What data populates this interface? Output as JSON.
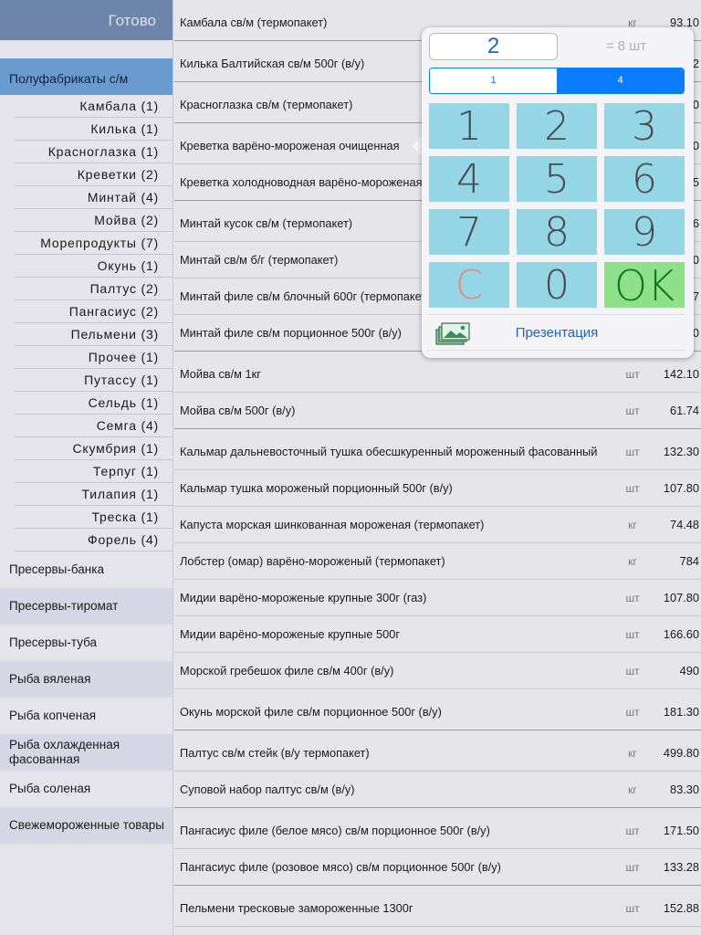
{
  "sidebar": {
    "done_label": "Готово",
    "selected_category": "Полуфабрикаты с/м",
    "subcategories": [
      "Камбала (1)",
      "Килька (1)",
      "Красноглазка (1)",
      "Креветки (2)",
      "Минтай (4)",
      "Мойва (2)",
      "Морепродукты (7)",
      "Окунь (1)",
      "Палтус (2)",
      "Пангасиус (2)",
      "Пельмени (3)",
      "Прочее (1)",
      "Путассу (1)",
      "Сельдь (1)",
      "Семга (4)",
      "Скумбрия (1)",
      "Терпуг (1)",
      "Тилапия (1)",
      "Треска (1)",
      "Форель (4)"
    ],
    "categories": [
      "Пресервы-банка",
      "Пресервы-тиромат",
      "Пресервы-туба",
      "Рыба вяленая",
      "Рыба копченая",
      "Рыба охлажденная фасованная",
      "Рыба соленая",
      "Свежемороженные товары"
    ]
  },
  "products": [
    {
      "name": "Камбала св/м (термопакет)",
      "unit": "кг",
      "price": "93.10"
    },
    {
      "name": "Килька Балтийская св/м 500г (в/у)",
      "unit": "шт",
      "price": "2"
    },
    {
      "name": "Красноглазка св/м (термопакет)",
      "unit": "кг",
      "price": "0"
    },
    {
      "name": "Креветка варёно-мороженая очищенная",
      "unit": "кг",
      "price": "0"
    },
    {
      "name": "Креветка холодноводная варёно-мороженая",
      "unit": "кг",
      "price": "5"
    },
    {
      "name": "Минтай кусок св/м (термопакет)",
      "unit": "кг",
      "price": "6"
    },
    {
      "name": "Минтай св/м б/г (термопакет)",
      "unit": "кг",
      "price": "0"
    },
    {
      "name": "Минтай филе св/м блочный 600г (термопакет)",
      "unit": "шт",
      "price": "7"
    },
    {
      "name": "Минтай филе св/м порционное 500г (в/у)",
      "unit": "шт",
      "price": "0"
    },
    {
      "name": "Мойва св/м 1кг",
      "unit": "шт",
      "price": "142.10"
    },
    {
      "name": "Мойва св/м 500г (в/у)",
      "unit": "шт",
      "price": "61.74"
    },
    {
      "name": "Кальмар дальневосточный тушка обесшкуренный мороженный фасованный",
      "unit": "шт",
      "price": "132.30"
    },
    {
      "name": "Кальмар тушка мороженый порционный 500г (в/у)",
      "unit": "шт",
      "price": "107.80"
    },
    {
      "name": "Капуста морская шинкованная мороженая (термопакет)",
      "unit": "кг",
      "price": "74.48"
    },
    {
      "name": "Лобстер (омар) варёно-мороженый (термопакет)",
      "unit": "кг",
      "price": "784"
    },
    {
      "name": "Мидии варёно-мороженые крупные 300г (газ)",
      "unit": "шт",
      "price": "107.80"
    },
    {
      "name": "Мидии варёно-мороженые крупные 500г",
      "unit": "шт",
      "price": "166.60"
    },
    {
      "name": "Морской гребешок филе св/м 400г (в/у)",
      "unit": "шт",
      "price": "490"
    },
    {
      "name": "Окунь морской филе св/м порционное 500г (в/у)",
      "unit": "шт",
      "price": "181.30"
    },
    {
      "name": "Палтус св/м стейк (в/у термопакет)",
      "unit": "кг",
      "price": "499.80"
    },
    {
      "name": "Суповой набор палтус св/м (в/у)",
      "unit": "кг",
      "price": "83.30"
    },
    {
      "name": "Пангасиус филе (белое мясо) св/м порционное 500г (в/у)",
      "unit": "шт",
      "price": "171.50"
    },
    {
      "name": "Пангасиус филе (розовое мясо) св/м порционное 500г (в/у)",
      "unit": "шт",
      "price": "133.28"
    },
    {
      "name": "Пельмени тресковые замороженные 1300г",
      "unit": "шт",
      "price": "152.88"
    }
  ],
  "popover": {
    "quantity_value": "2",
    "total_text": "= 8 шт",
    "segments": [
      "1",
      "4"
    ],
    "active_segment": "4",
    "keys": [
      "1",
      "2",
      "3",
      "4",
      "5",
      "6",
      "7",
      "8",
      "9",
      "C",
      "0",
      "OK"
    ],
    "presentation_label": "Презентация",
    "presentation_icon": "photos-stack-icon"
  },
  "colors": {
    "accent": "#0a7cff",
    "key_bg": "#95d6e6",
    "ok_bg": "#8fe08a",
    "clear_text": "#e08b7c",
    "done_bar": "#6d85a8",
    "selected_category_bg": "#6a9bd0"
  }
}
